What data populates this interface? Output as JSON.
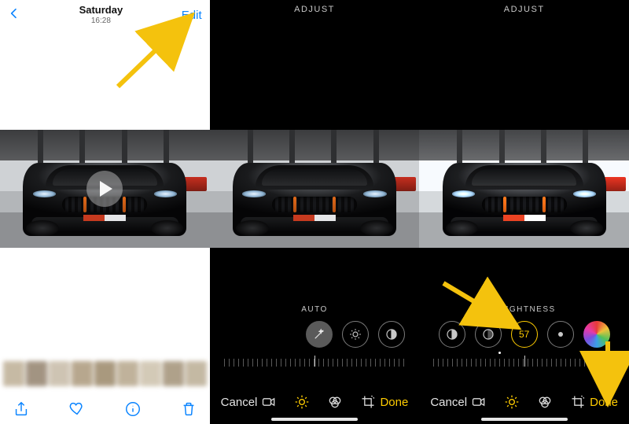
{
  "panel1": {
    "header": {
      "day": "Saturday",
      "time": "16:28",
      "edit": "Edit"
    },
    "toolbar": [
      "share",
      "favorite",
      "info",
      "delete"
    ]
  },
  "panel2": {
    "header": "ADJUST",
    "section_label": "AUTO",
    "dials": [
      {
        "id": "auto-wand",
        "kind": "solid-wand"
      },
      {
        "id": "exposure",
        "kind": "exposure"
      },
      {
        "id": "contrast",
        "kind": "contrast"
      }
    ],
    "toolbar": {
      "cancel": "Cancel",
      "done": "Done"
    }
  },
  "panel3": {
    "header": "ADJUST",
    "section_label": "BRIGHTNESS",
    "dials": [
      {
        "id": "contrast",
        "kind": "contrast"
      },
      {
        "id": "brightness",
        "kind": "brightness"
      },
      {
        "id": "value",
        "kind": "value",
        "value": "57",
        "active": true
      },
      {
        "id": "black-point",
        "kind": "dot"
      },
      {
        "id": "saturation",
        "kind": "rainbow"
      }
    ],
    "toolbar": {
      "cancel": "Cancel",
      "done": "Done"
    }
  }
}
